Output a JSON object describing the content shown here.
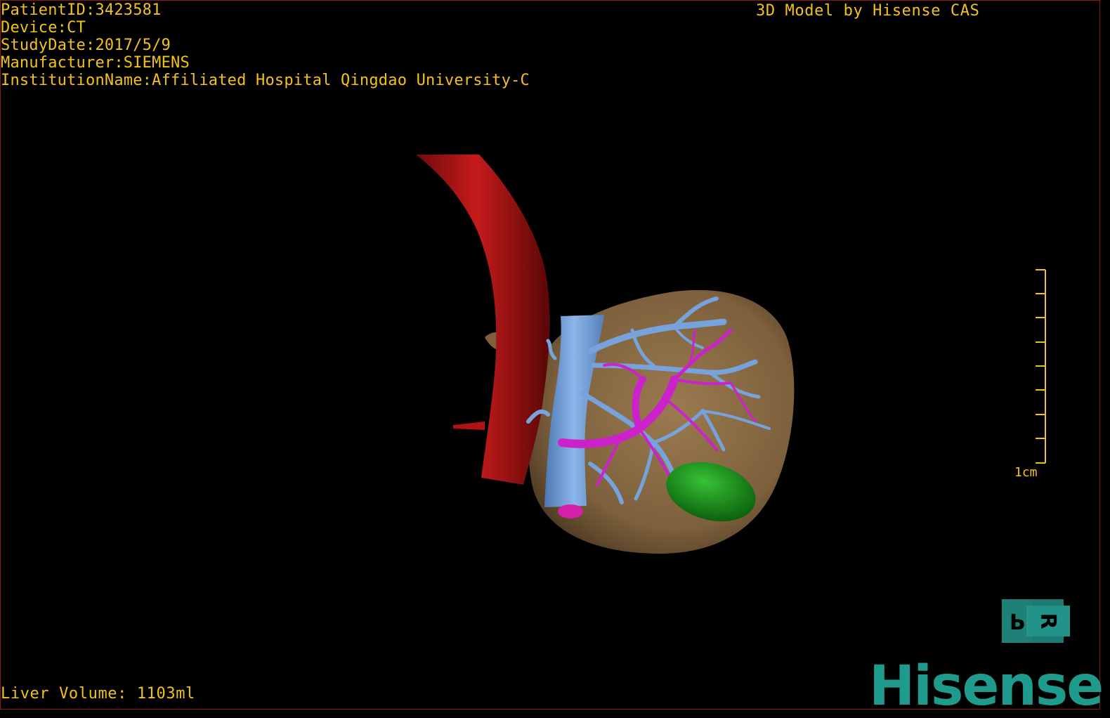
{
  "header": {
    "patient_id": "PatientID:3423581",
    "device": "Device:CT",
    "study_date": "StudyDate:2017/5/9",
    "manufacturer": "Manufacturer:SIEMENS",
    "institution": "InstitutionName:Affiliated Hospital Qingdao University-C",
    "credit": "3D Model by Hisense CAS"
  },
  "footer": {
    "liver_volume": "Liver Volume: 1103ml"
  },
  "scale_bar": {
    "label": "1cm"
  },
  "orientation_cube": {
    "face_a": "P",
    "face_b": "R"
  },
  "brand": {
    "logo_text": "Hisense"
  },
  "colors": {
    "overlay_text": "#f2c21a",
    "aorta": "#b31212",
    "vena_cava": "#76a3db",
    "portal_vein": "#cc22cc",
    "liver": "#8a6a43",
    "tumor": "#1a9a1a",
    "brand": "#1f9b8e"
  }
}
